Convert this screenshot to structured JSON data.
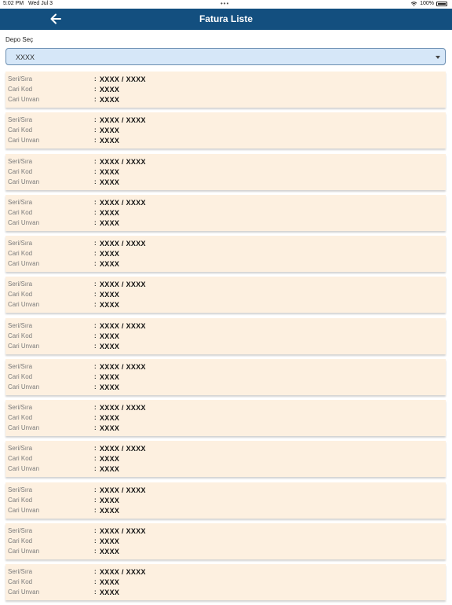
{
  "status_bar": {
    "time": "5:02 PM",
    "date": "Wed Jul 3",
    "battery": "100%"
  },
  "header": {
    "title": "Fatura Liste"
  },
  "depo": {
    "label": "Depo Seç",
    "selected": "XXXX"
  },
  "labels": {
    "seri_sira": "Seri/Sıra",
    "cari_kod": "Cari Kod",
    "cari_unvan": "Cari Unvan",
    "separator": ":"
  },
  "invoices": [
    {
      "seri_sira": "XXXX / XXXX",
      "cari_kod": "XXXX",
      "cari_unvan": "XXXX"
    },
    {
      "seri_sira": "XXXX / XXXX",
      "cari_kod": "XXXX",
      "cari_unvan": "XXXX"
    },
    {
      "seri_sira": "XXXX / XXXX",
      "cari_kod": "XXXX",
      "cari_unvan": "XXXX"
    },
    {
      "seri_sira": "XXXX / XXXX",
      "cari_kod": "XXXX",
      "cari_unvan": "XXXX"
    },
    {
      "seri_sira": "XXXX / XXXX",
      "cari_kod": "XXXX",
      "cari_unvan": "XXXX"
    },
    {
      "seri_sira": "XXXX / XXXX",
      "cari_kod": "XXXX",
      "cari_unvan": "XXXX"
    },
    {
      "seri_sira": "XXXX / XXXX",
      "cari_kod": "XXXX",
      "cari_unvan": "XXXX"
    },
    {
      "seri_sira": "XXXX / XXXX",
      "cari_kod": "XXXX",
      "cari_unvan": "XXXX"
    },
    {
      "seri_sira": "XXXX / XXXX",
      "cari_kod": "XXXX",
      "cari_unvan": "XXXX"
    },
    {
      "seri_sira": "XXXX / XXXX",
      "cari_kod": "XXXX",
      "cari_unvan": "XXXX"
    },
    {
      "seri_sira": "XXXX / XXXX",
      "cari_kod": "XXXX",
      "cari_unvan": "XXXX"
    },
    {
      "seri_sira": "XXXX / XXXX",
      "cari_kod": "XXXX",
      "cari_unvan": "XXXX"
    },
    {
      "seri_sira": "XXXX / XXXX",
      "cari_kod": "XXXX",
      "cari_unvan": "XXXX"
    }
  ],
  "colors": {
    "header_bg": "#134f7f",
    "card_bg": "#fdf0e0",
    "select_bg": "#d6e7f8"
  },
  "icons": {
    "back": "arrow-left-icon",
    "dropdown": "chevron-down-icon",
    "wifi": "wifi-icon",
    "battery": "battery-icon"
  }
}
